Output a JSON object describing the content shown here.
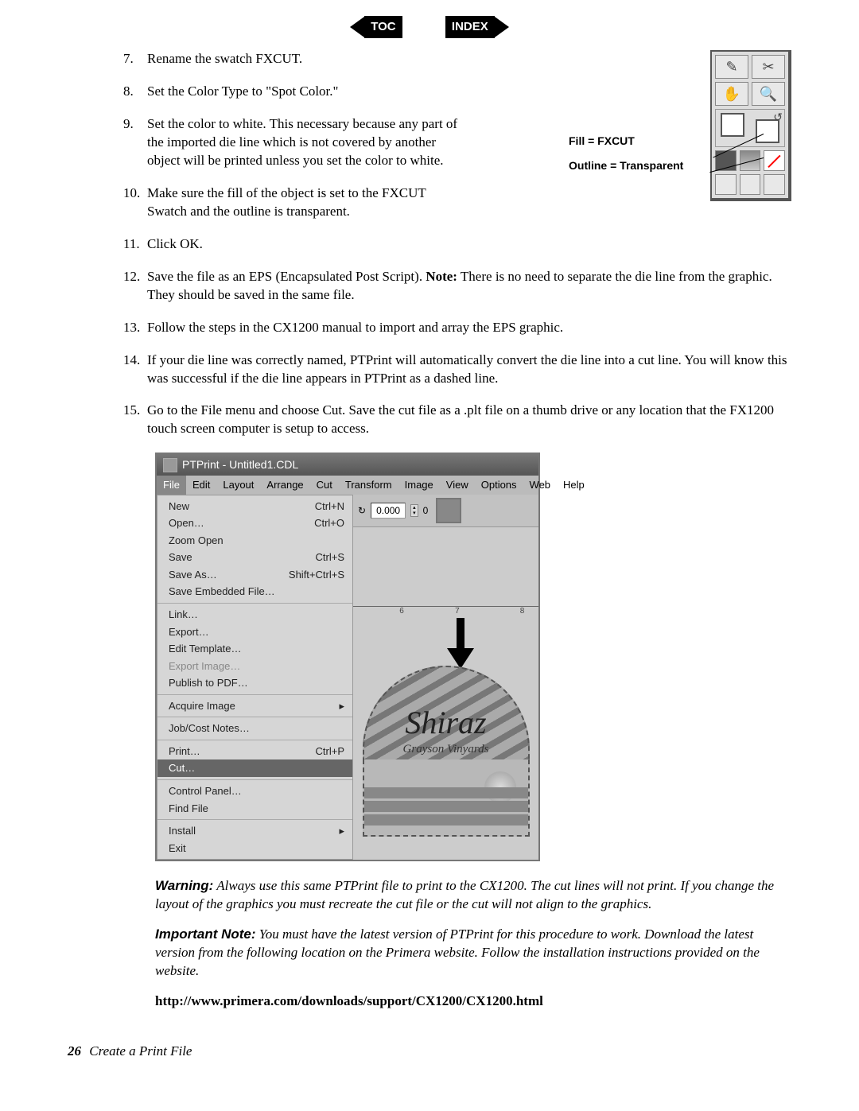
{
  "nav": {
    "toc": "TOC",
    "index": "INDEX"
  },
  "side": {
    "fill": "Fill = FXCUT",
    "outline": "Outline = Transparent"
  },
  "steps": [
    {
      "n": "7.",
      "t": "Rename the swatch FXCUT."
    },
    {
      "n": "8.",
      "t": "Set the Color Type to \"Spot Color.\""
    },
    {
      "n": "9.",
      "t": "Set the color to white.  This necessary because any part of the imported die line which is not covered by another object will be printed unless you set the color to white."
    },
    {
      "n": "10.",
      "t": "Make sure the fill of the object is set to the FXCUT Swatch and the outline is transparent."
    },
    {
      "n": "11.",
      "t": "Click OK."
    },
    {
      "n": "12.",
      "t_pre": "Save the file as an EPS (Encapsulated Post Script).  ",
      "t_bold": "Note:",
      "t_post": " There is no need to separate the die line from the graphic. They should be saved in the same file."
    },
    {
      "n": "13.",
      "t": "Follow the steps in the CX1200 manual to import and array the EPS graphic."
    },
    {
      "n": "14.",
      "t": "If your die line was correctly named, PTPrint will automatically convert the die line into a cut line.  You will know this was successful if the die line appears in PTPrint as a dashed line."
    },
    {
      "n": "15.",
      "t": "Go to the File menu and choose Cut. Save the cut file as a .plt file on a thumb drive or any location that the FX1200 touch screen computer is setup to access."
    }
  ],
  "app": {
    "title": "PTPrint - Untitled1.CDL",
    "menus": [
      "File",
      "Edit",
      "Layout",
      "Arrange",
      "Cut",
      "Transform",
      "Image",
      "View",
      "Options",
      "Web",
      "Help"
    ],
    "toolbar": {
      "rotate_icon": "↻",
      "value": "0.000",
      "zero": "0"
    },
    "file_menu": {
      "g1": [
        {
          "l": "New",
          "s": "Ctrl+N"
        },
        {
          "l": "Open…",
          "s": "Ctrl+O"
        },
        {
          "l": "Zoom Open",
          "s": ""
        },
        {
          "l": "Save",
          "s": "Ctrl+S"
        },
        {
          "l": "Save As…",
          "s": "Shift+Ctrl+S"
        },
        {
          "l": "Save Embedded File…",
          "s": ""
        }
      ],
      "g2": [
        {
          "l": "Link…"
        },
        {
          "l": "Export…"
        },
        {
          "l": "Edit Template…"
        },
        {
          "l": "Export Image…",
          "disabled": true
        },
        {
          "l": "Publish to PDF…"
        }
      ],
      "g3": [
        {
          "l": "Acquire Image",
          "arrow": "▸"
        }
      ],
      "g4": [
        {
          "l": "Job/Cost Notes…"
        }
      ],
      "g5": [
        {
          "l": "Print…",
          "s": "Ctrl+P"
        },
        {
          "l": "Cut…",
          "hl": true
        }
      ],
      "g6": [
        {
          "l": "Control Panel…"
        },
        {
          "l": "Find File"
        }
      ],
      "g7": [
        {
          "l": "Install",
          "arrow": "▸"
        },
        {
          "l": "Exit"
        }
      ]
    },
    "ruler": {
      "a": "6",
      "b": "7",
      "c": "8"
    },
    "label": {
      "title": "Shiraz",
      "sub": "Grayson Vinyards"
    }
  },
  "warning": {
    "lead": "Warning:",
    "body": "  Always use this same PTPrint file to print to the CX1200.  The cut lines will not print.  If you change the layout of the graphics you must recreate the cut file or the cut will not align to the graphics."
  },
  "important": {
    "lead": "Important Note:",
    "body": " You must have the latest version of PTPrint for this procedure to work.  Download the latest version from the following location on the Primera website.  Follow the installation instructions provided on the website."
  },
  "url": "http://www.primera.com/downloads/support/CX1200/CX1200.html",
  "footer": {
    "page": "26",
    "title": "Create a Print File"
  }
}
